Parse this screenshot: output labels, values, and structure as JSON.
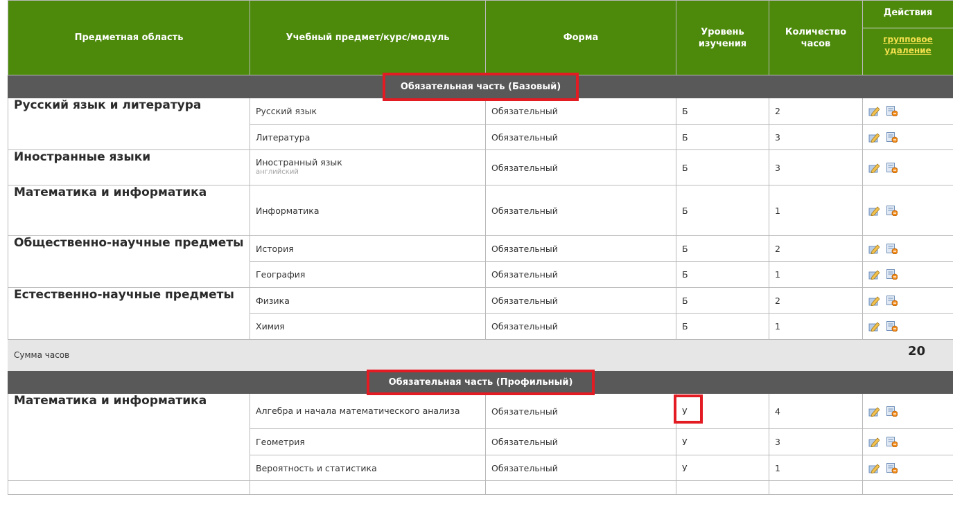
{
  "columns": {
    "area": "Предметная область",
    "subject": "Учебный предмет/курс/модуль",
    "form": "Форма",
    "level": "Уровень изучения",
    "hours": "Количество часов",
    "actions": "Действия",
    "group_delete": "групповое удаление"
  },
  "section1": {
    "title": "Обязательная часть (Базовый)",
    "rows": [
      {
        "area": "Русский язык и литература",
        "subject": "Русский язык",
        "form": "Обязательный",
        "level": "Б",
        "hours": "2"
      },
      {
        "subject": "Литература",
        "form": "Обязательный",
        "level": "Б",
        "hours": "3"
      },
      {
        "area": "Иностранные языки",
        "subject": "Иностранный язык",
        "note": "английский",
        "form": "Обязательный",
        "level": "Б",
        "hours": "3"
      },
      {
        "area": "Математика и информатика",
        "subject": "Информатика",
        "form": "Обязательный",
        "level": "Б",
        "hours": "1"
      },
      {
        "area": "Общественно-научные предметы",
        "subject": "История",
        "form": "Обязательный",
        "level": "Б",
        "hours": "2"
      },
      {
        "subject": "География",
        "form": "Обязательный",
        "level": "Б",
        "hours": "1"
      },
      {
        "area": "Естественно-научные предметы",
        "subject": "Физика",
        "form": "Обязательный",
        "level": "Б",
        "hours": "2"
      },
      {
        "subject": "Химия",
        "form": "Обязательный",
        "level": "Б",
        "hours": "1"
      }
    ]
  },
  "sum": {
    "label": "Сумма часов",
    "value": "20"
  },
  "section2": {
    "title": "Обязательная часть (Профильный)",
    "rows": [
      {
        "area": "Математика и информатика",
        "subject": "Алгебра и начала математического анализа",
        "form": "Обязательный",
        "level": "У",
        "hours": "4"
      },
      {
        "subject": "Геометрия",
        "form": "Обязательный",
        "level": "У",
        "hours": "3"
      },
      {
        "subject": "Вероятность и статистика",
        "form": "Обязательный",
        "level": "У",
        "hours": "1"
      }
    ]
  },
  "icons": {
    "edit": "edit-icon",
    "delete": "delete-icon"
  },
  "colors": {
    "header_bg": "#4d8a0c",
    "section_bg": "#595959",
    "highlight": "#e31b23",
    "link": "#f4e04d"
  }
}
